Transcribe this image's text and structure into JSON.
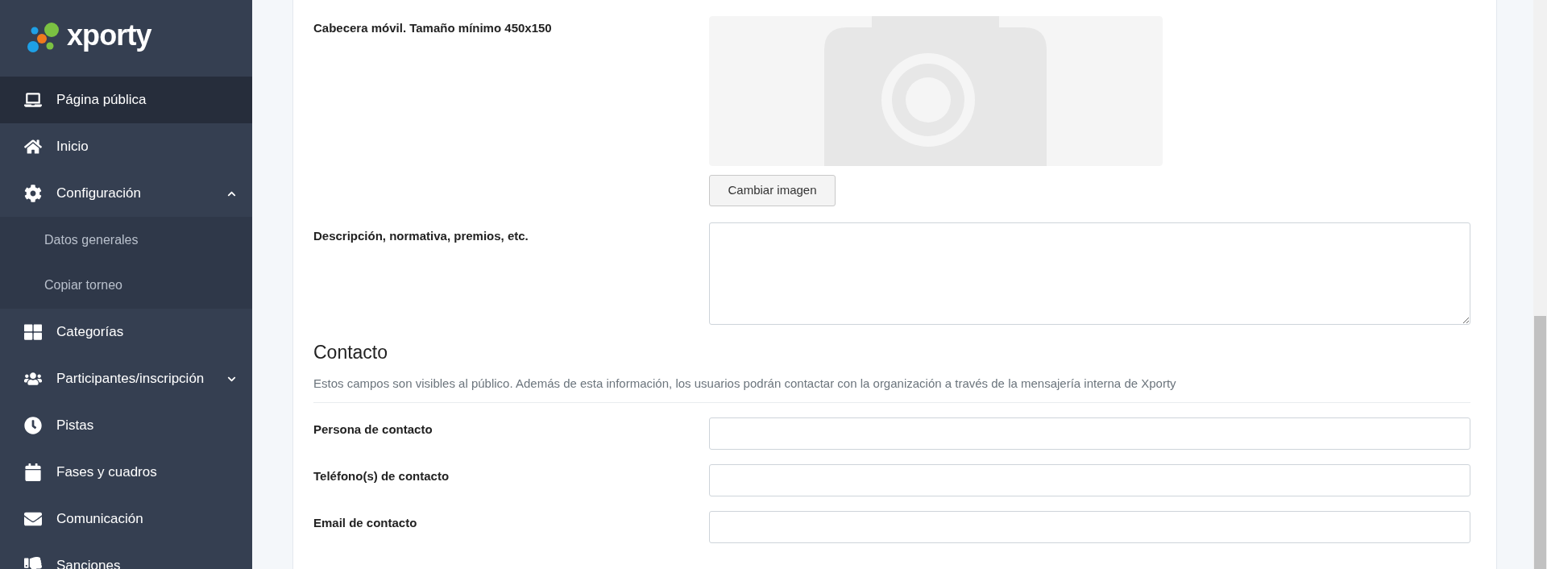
{
  "logo": {
    "text": "xporty"
  },
  "sidebar": {
    "items": [
      {
        "label": "Página pública",
        "selected": true
      },
      {
        "label": "Inicio",
        "selected": false
      },
      {
        "label": "Configuración",
        "selected": false,
        "expanded": true,
        "children": [
          {
            "label": "Datos generales",
            "selected": false
          },
          {
            "label": "Copiar torneo",
            "selected": false
          }
        ]
      },
      {
        "label": "Categorías",
        "selected": false
      },
      {
        "label": "Participantes/inscripción",
        "selected": false,
        "expanded": false
      },
      {
        "label": "Pistas",
        "selected": false
      },
      {
        "label": "Fases y cuadros",
        "selected": false
      },
      {
        "label": "Comunicación",
        "selected": false
      },
      {
        "label": "Sanciones",
        "selected": false
      }
    ]
  },
  "form": {
    "mobile_header": {
      "label": "Cabecera móvil. Tamaño mínimo 450x150",
      "button": "Cambiar imagen"
    },
    "description": {
      "label": "Descripción, normativa, premios, etc."
    },
    "contact": {
      "heading": "Contacto",
      "note": "Estos campos son visibles al público. Además de esta información, los usuarios podrán contactar con la organización a través de la mensajería interna de Xporty",
      "fields": [
        {
          "label": "Persona de contacto"
        },
        {
          "label": "Teléfono(s) de contacto"
        },
        {
          "label": "Email de contacto"
        }
      ]
    }
  }
}
